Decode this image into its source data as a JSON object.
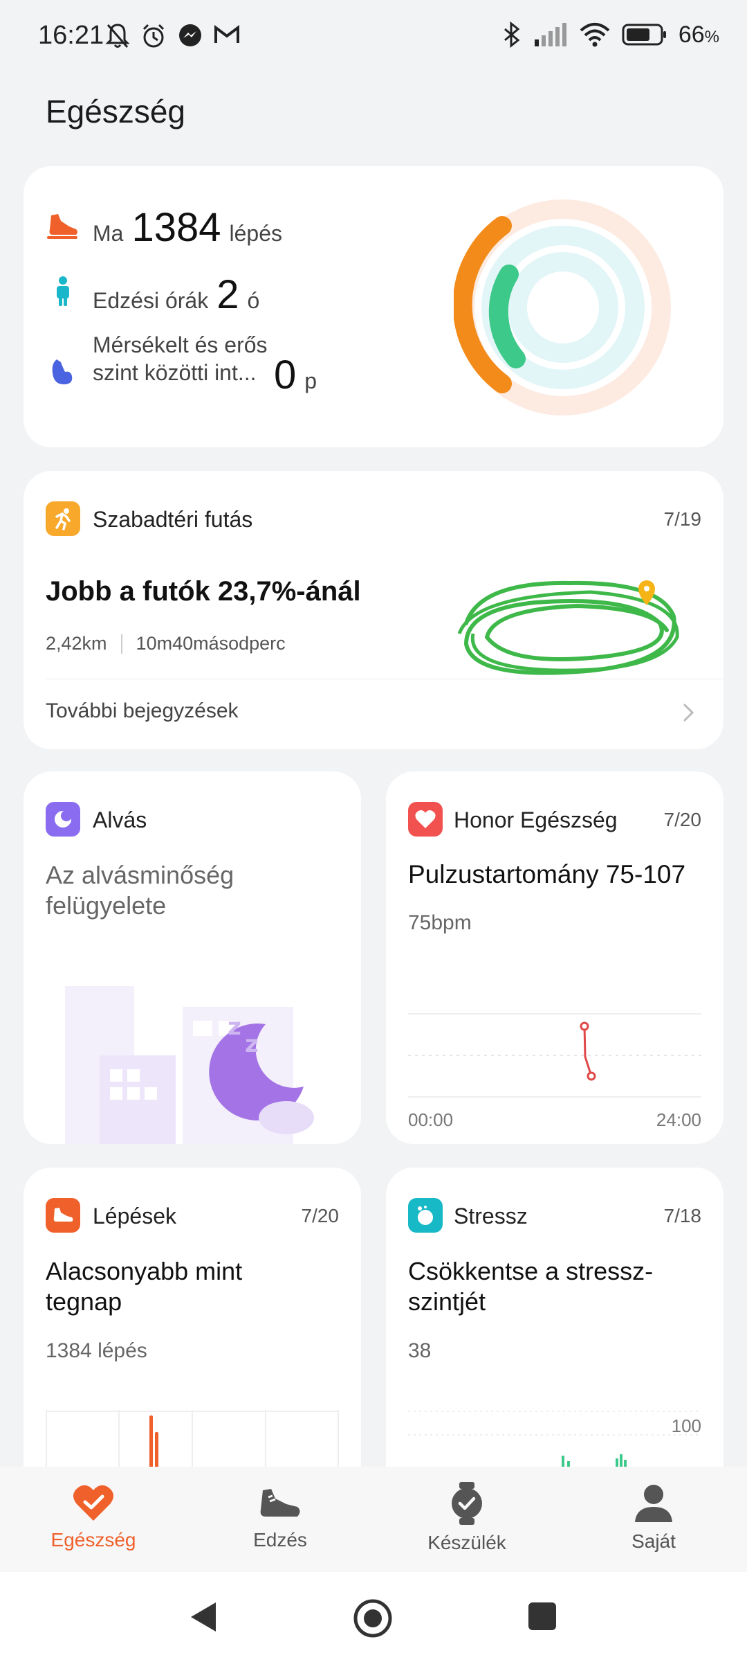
{
  "status_bar": {
    "time": "16:21",
    "battery_percent": "66",
    "battery_suffix": "%",
    "left_icons": [
      "bell-off-icon",
      "alarm-icon",
      "messenger-icon",
      "gmail-icon"
    ],
    "right_icons": [
      "bluetooth-icon",
      "signal-icon",
      "wifi-icon",
      "battery-icon"
    ]
  },
  "page": {
    "title": "Egészség"
  },
  "activity": {
    "steps_label": "Ma",
    "steps_value": "1384",
    "steps_unit": "lépés",
    "exercise_label": "Edzési órák",
    "exercise_value": "2",
    "exercise_unit": "ó",
    "intensity_label": "Mérsékelt és erős szint közötti int...",
    "intensity_value": "0",
    "intensity_unit": "p",
    "ring_colors": {
      "steps": "#f7a21b",
      "exercise": "#35c58a",
      "intensity": "#63b8e6"
    }
  },
  "running": {
    "label": "Szabadtéri futás",
    "date": "7/19",
    "headline": "Jobb a futók 23,7%-ánál",
    "distance": "2,42km",
    "duration": "10m40másodperc",
    "more_link": "További bejegyzések"
  },
  "sleep": {
    "label": "Alvás",
    "description": "Az alvásminőség felügyelete"
  },
  "heart": {
    "label": "Honor Egészség",
    "date": "7/20",
    "headline": "Pulzustartomány 75-107",
    "value": "75bpm",
    "x_start": "00:00",
    "x_end": "24:00"
  },
  "steps": {
    "label": "Lépések",
    "date": "7/20",
    "headline": "Alacsonyabb mint tegnap",
    "value": "1384 lépés"
  },
  "stress": {
    "label": "Stressz",
    "date": "7/18",
    "headline": "Csökkentse a stressz-szintjét",
    "value": "38",
    "axis_max": "100"
  },
  "bottom_nav": {
    "items": [
      {
        "label": "Egészség",
        "active": true
      },
      {
        "label": "Edzés",
        "active": false
      },
      {
        "label": "Készülék",
        "active": false
      },
      {
        "label": "Saját",
        "active": false
      }
    ],
    "active_color": "#f0602a"
  }
}
